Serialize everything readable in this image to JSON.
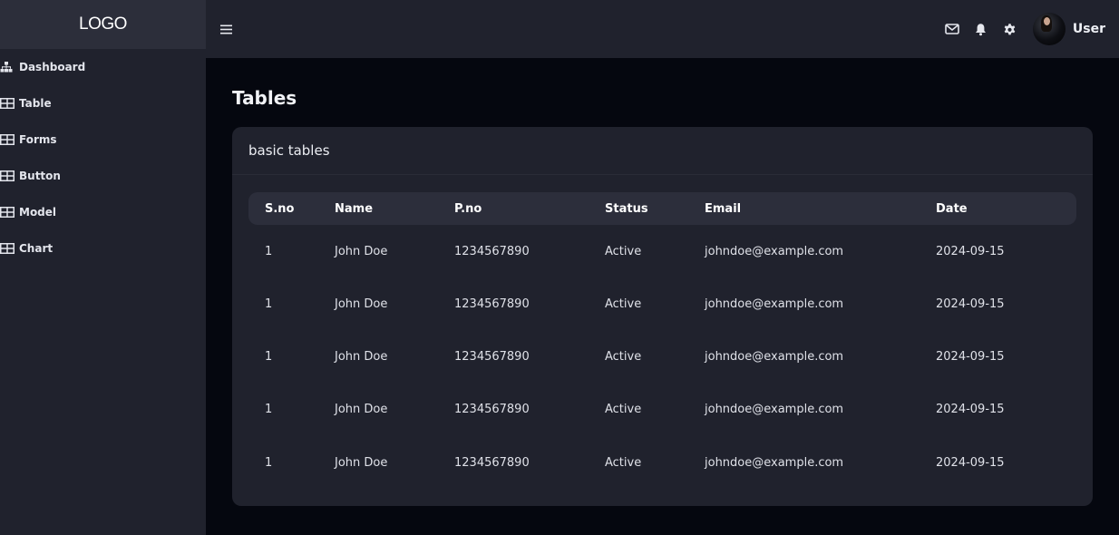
{
  "sidebar": {
    "logo": "LOGO",
    "items": [
      {
        "label": "Dashboard",
        "icon": "sitemap-icon"
      },
      {
        "label": "Table",
        "icon": "grid-icon"
      },
      {
        "label": "Forms",
        "icon": "grid-icon"
      },
      {
        "label": "Button",
        "icon": "grid-icon"
      },
      {
        "label": "Model",
        "icon": "grid-icon"
      },
      {
        "label": "Chart",
        "icon": "grid-icon"
      }
    ]
  },
  "topbar": {
    "menu_icon": "hamburger-menu-icon",
    "icons": [
      "mail-icon",
      "bell-icon",
      "gear-icon"
    ],
    "user_name": "User"
  },
  "main": {
    "page_title": "Tables",
    "card": {
      "title": "basic tables",
      "table": {
        "columns": [
          "S.no",
          "Name",
          "P.no",
          "Status",
          "Email",
          "Date"
        ],
        "rows": [
          [
            "1",
            "John Doe",
            "1234567890",
            "Active",
            "johndoe@example.com",
            "2024-09-15"
          ],
          [
            "1",
            "John Doe",
            "1234567890",
            "Active",
            "johndoe@example.com",
            "2024-09-15"
          ],
          [
            "1",
            "John Doe",
            "1234567890",
            "Active",
            "johndoe@example.com",
            "2024-09-15"
          ],
          [
            "1",
            "John Doe",
            "1234567890",
            "Active",
            "johndoe@example.com",
            "2024-09-15"
          ],
          [
            "1",
            "John Doe",
            "1234567890",
            "Active",
            "johndoe@example.com",
            "2024-09-15"
          ]
        ]
      }
    }
  },
  "colors": {
    "page_bg": "#05070f",
    "panel_bg": "#20222d",
    "logo_bg": "#2c2e3a",
    "table_header_bg": "#2c2e3b",
    "text": "#e6e8ee"
  }
}
